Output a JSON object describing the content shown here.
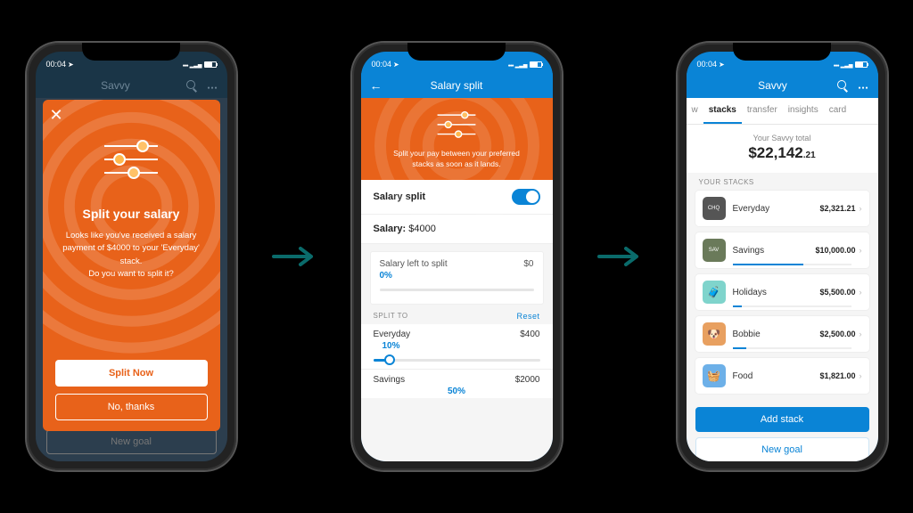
{
  "status_time": "00:04",
  "phone1": {
    "nav_title": "Savvy",
    "heading": "Split your salary",
    "body_l1": "Looks like you've received a salary",
    "body_l2": "payment of $4000 to your 'Everyday'",
    "body_l3": "stack.",
    "body_l4": "Do you want to split it?",
    "primary": "Split Now",
    "secondary": "No, thanks",
    "underlay_btn": "New goal"
  },
  "phone2": {
    "nav_title": "Salary split",
    "hero_l1": "Split your pay between your preferred",
    "hero_l2": "stacks as soon as it lands.",
    "toggle_label": "Salary split",
    "salary_label": "Salary:",
    "salary_value": "$4000",
    "left_label": "Salary left to split",
    "left_value": "$0",
    "left_pct": "0%",
    "split_to": "SPLIT TO",
    "reset": "Reset",
    "rows": {
      "everyday_name": "Everyday",
      "everyday_amt": "$400",
      "everyday_pct": "10%",
      "savings_name": "Savings",
      "savings_amt": "$2000",
      "savings_pct": "50%"
    }
  },
  "phone3": {
    "nav_title": "Savvy",
    "tabs": {
      "t0": "w",
      "t1": "stacks",
      "t2": "transfer",
      "t3": "insights",
      "t4": "card"
    },
    "total_label": "Your Savvy total",
    "total_whole": "$22,142",
    "total_cents": ".21",
    "section": "YOUR STACKS",
    "stacks": {
      "s0_name": "Everyday",
      "s0_amt": "$2,321.21",
      "s1_name": "Savings",
      "s1_amt": "$10,000.00",
      "s2_name": "Holidays",
      "s2_amt": "$5,500.00",
      "s3_name": "Bobbie",
      "s3_amt": "$2,500.00",
      "s4_name": "Food",
      "s4_amt": "$1,821.00"
    },
    "add_stack": "Add stack",
    "new_goal": "New goal"
  }
}
